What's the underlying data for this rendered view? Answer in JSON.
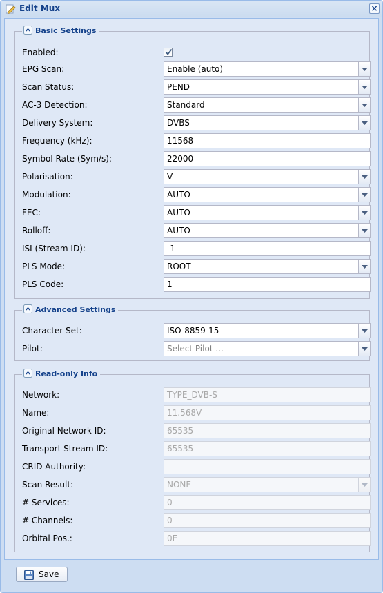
{
  "window": {
    "title": "Edit Mux",
    "close_label": "×"
  },
  "basic": {
    "legend": "Basic Settings",
    "enabled_label": "Enabled:",
    "enabled_checked": true,
    "epg_scan": {
      "label": "EPG Scan:",
      "value": "Enable (auto)"
    },
    "scan_status": {
      "label": "Scan Status:",
      "value": "PEND"
    },
    "ac3": {
      "label": "AC-3 Detection:",
      "value": "Standard"
    },
    "delivery": {
      "label": "Delivery System:",
      "value": "DVBS"
    },
    "frequency": {
      "label": "Frequency (kHz):",
      "value": "11568"
    },
    "symbol_rate": {
      "label": "Symbol Rate (Sym/s):",
      "value": "22000"
    },
    "polarisation": {
      "label": "Polarisation:",
      "value": "V"
    },
    "modulation": {
      "label": "Modulation:",
      "value": "AUTO"
    },
    "fec": {
      "label": "FEC:",
      "value": "AUTO"
    },
    "rolloff": {
      "label": "Rolloff:",
      "value": "AUTO"
    },
    "isi": {
      "label": "ISI (Stream ID):",
      "value": "-1"
    },
    "pls_mode": {
      "label": "PLS Mode:",
      "value": "ROOT"
    },
    "pls_code": {
      "label": "PLS Code:",
      "value": "1"
    }
  },
  "advanced": {
    "legend": "Advanced Settings",
    "charset": {
      "label": "Character Set:",
      "value": "ISO-8859-15"
    },
    "pilot": {
      "label": "Pilot:",
      "placeholder": "Select Pilot ..."
    }
  },
  "readonly": {
    "legend": "Read-only Info",
    "network": {
      "label": "Network:",
      "value": "TYPE_DVB-S"
    },
    "name": {
      "label": "Name:",
      "value": "11.568V"
    },
    "onid": {
      "label": "Original Network ID:",
      "value": "65535"
    },
    "tsid": {
      "label": "Transport Stream ID:",
      "value": "65535"
    },
    "crid": {
      "label": "CRID Authority:",
      "value": ""
    },
    "scan_result": {
      "label": "Scan Result:",
      "value": "NONE"
    },
    "services": {
      "label": "# Services:",
      "value": "0"
    },
    "channels": {
      "label": "# Channels:",
      "value": "0"
    },
    "orbital": {
      "label": "Orbital Pos.:",
      "value": "0E"
    }
  },
  "footer": {
    "save_label": "Save"
  },
  "icons": {
    "title": "edit-pencil-icon",
    "collapse": "collapse-minus-icon",
    "combo": "chevron-down-icon",
    "save": "save-disk-icon"
  },
  "colors": {
    "accent": "#15428b",
    "panel": "#dfe8f6",
    "border": "#99bbe8"
  }
}
